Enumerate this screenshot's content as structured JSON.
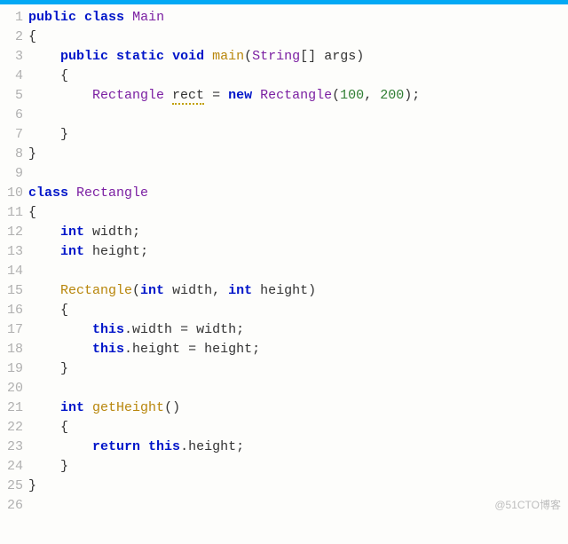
{
  "watermark": "@51CTO博客",
  "lines": {
    "start": 1,
    "end": 26
  },
  "t": {
    "public": "public",
    "class": "class",
    "static": "static",
    "void": "void",
    "new": "new",
    "return": "return",
    "int": "int",
    "this": "this",
    "Main": "Main",
    "Rectangle": "Rectangle",
    "main": "main",
    "String": "String",
    "args": "args",
    "rect": "rect",
    "n100": "100",
    "n200": "200",
    "width": "width",
    "height": "height",
    "getHeight": "getHeight",
    "lbrace": "{",
    "rbrace": "}",
    "lparen": "(",
    "rparen": ")",
    "lbrack": "[",
    "rbrack": "]",
    "semi": ";",
    "comma": ",",
    "eq": "=",
    "dot": "."
  }
}
